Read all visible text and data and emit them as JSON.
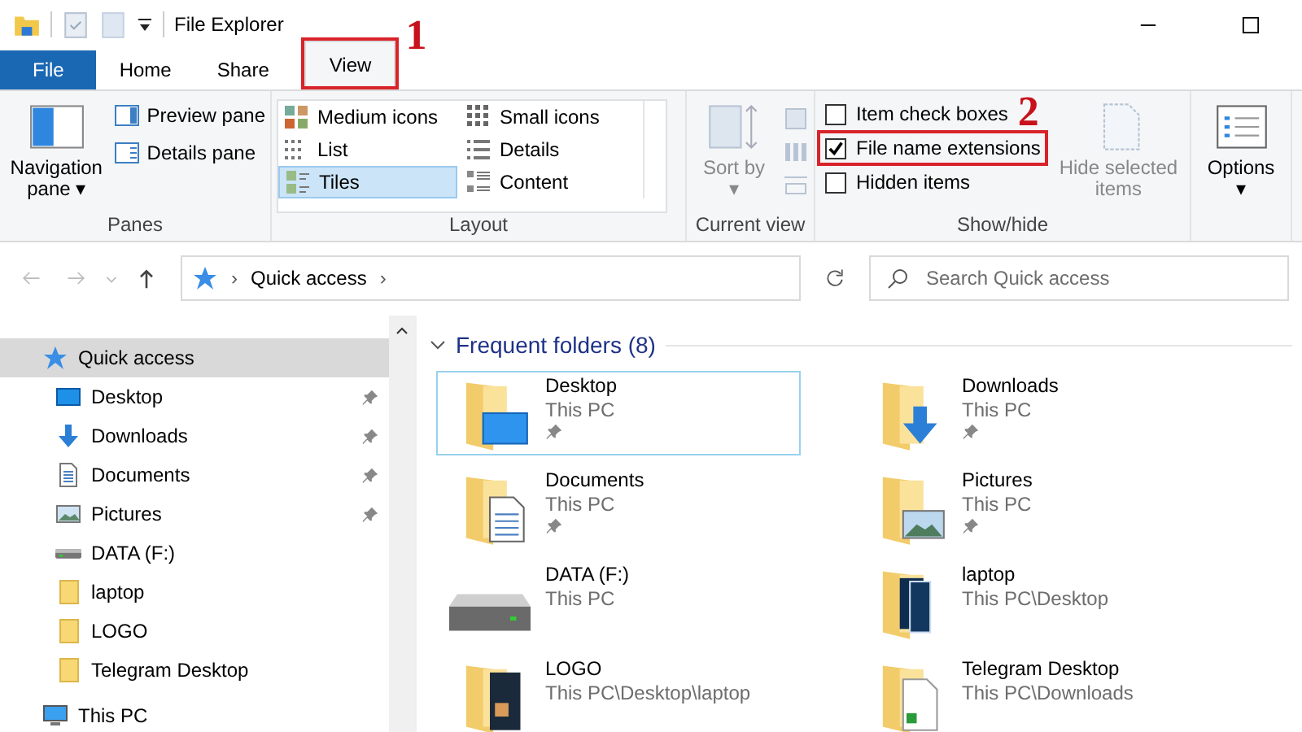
{
  "window": {
    "title": "File Explorer"
  },
  "tabs": [
    {
      "label": "File",
      "kind": "file",
      "selected": false
    },
    {
      "label": "Home",
      "kind": "tab",
      "selected": false
    },
    {
      "label": "Share",
      "kind": "tab",
      "selected": false
    },
    {
      "label": "View",
      "kind": "tab",
      "selected": true,
      "callout": "1"
    }
  ],
  "ribbon": {
    "panes": {
      "title": "Panes",
      "navigation": "Navigation pane",
      "navigation_caret": "▾",
      "preview": "Preview pane",
      "details": "Details pane"
    },
    "layout": {
      "title": "Layout",
      "options": [
        {
          "label": "Medium icons",
          "kind": "medium",
          "selected": false
        },
        {
          "label": "Small icons",
          "kind": "small",
          "selected": false
        },
        {
          "label": "List",
          "kind": "list",
          "selected": false
        },
        {
          "label": "Details",
          "kind": "details",
          "selected": false
        },
        {
          "label": "Tiles",
          "kind": "tiles",
          "selected": true
        },
        {
          "label": "Content",
          "kind": "content",
          "selected": false
        }
      ]
    },
    "current_view": {
      "title": "Current view",
      "sort": "Sort by",
      "sort_caret": "▾"
    },
    "show_hide": {
      "title": "Show/hide",
      "checkboxes": [
        {
          "label": "Item check boxes",
          "checked": false
        },
        {
          "label": "File name extensions",
          "checked": true,
          "callout": "2"
        },
        {
          "label": "Hidden items",
          "checked": false
        }
      ],
      "hide_selected": "Hide selected items"
    },
    "options": {
      "label": "Options",
      "caret": "▾"
    }
  },
  "address": {
    "crumbs": [
      {
        "text": "›",
        "kind": "separator"
      },
      {
        "text": "Quick access",
        "kind": "location"
      },
      {
        "text": "›",
        "kind": "separator"
      }
    ],
    "search_placeholder": "Search Quick access"
  },
  "sidebar": {
    "items": [
      {
        "label": "Quick access",
        "kind": "star",
        "selected": true,
        "children": [
          {
            "label": "Desktop",
            "kind": "desktop",
            "selected": false,
            "pinned": true
          },
          {
            "label": "Downloads",
            "kind": "downloads",
            "selected": false,
            "pinned": true
          },
          {
            "label": "Documents",
            "kind": "documents",
            "selected": false,
            "pinned": true
          },
          {
            "label": "Pictures",
            "kind": "pictures",
            "selected": false,
            "pinned": true
          },
          {
            "label": "DATA (F:)",
            "kind": "drive",
            "selected": false,
            "pinned": false
          },
          {
            "label": "laptop",
            "kind": "folder",
            "selected": false,
            "pinned": false
          },
          {
            "label": "LOGO",
            "kind": "folder",
            "selected": false,
            "pinned": false
          },
          {
            "label": "Telegram Desktop",
            "kind": "folder",
            "selected": false,
            "pinned": false
          }
        ]
      },
      {
        "label": "This PC",
        "kind": "pc",
        "selected": false
      }
    ]
  },
  "content": {
    "section": {
      "title": "Frequent folders (8)",
      "expanded": true
    },
    "tiles": [
      {
        "name": "Desktop",
        "location": "This PC",
        "kind": "desktop",
        "pinned": true,
        "selected": true
      },
      {
        "name": "Downloads",
        "location": "This PC",
        "kind": "downloads",
        "pinned": true,
        "selected": false
      },
      {
        "name": "Documents",
        "location": "This PC",
        "kind": "documents",
        "pinned": true,
        "selected": false
      },
      {
        "name": "Pictures",
        "location": "This PC",
        "kind": "pictures",
        "pinned": true,
        "selected": false
      },
      {
        "name": "DATA (F:)",
        "location": "This PC",
        "kind": "drive",
        "pinned": false,
        "selected": false
      },
      {
        "name": "laptop",
        "location": "This PC\\Desktop",
        "kind": "ps",
        "pinned": false,
        "selected": false
      },
      {
        "name": "LOGO",
        "location": "This PC\\Desktop\\laptop",
        "kind": "dark",
        "pinned": false,
        "selected": false
      },
      {
        "name": "Telegram Desktop",
        "location": "This PC\\Downloads",
        "kind": "docs",
        "pinned": false,
        "selected": false
      }
    ]
  }
}
